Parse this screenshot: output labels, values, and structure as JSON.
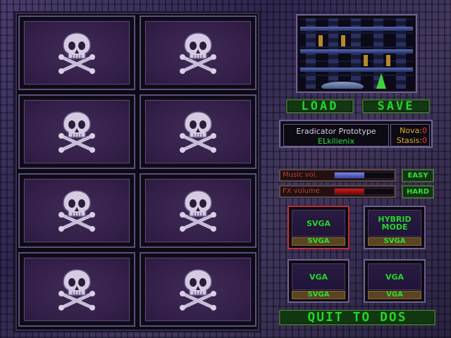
{
  "save_slots": [
    {
      "icon": "skull-crossbones-icon"
    },
    {
      "icon": "skull-crossbones-icon"
    },
    {
      "icon": "skull-crossbones-icon"
    },
    {
      "icon": "skull-crossbones-icon"
    },
    {
      "icon": "skull-crossbones-icon"
    },
    {
      "icon": "skull-crossbones-icon"
    },
    {
      "icon": "skull-crossbones-icon"
    },
    {
      "icon": "skull-crossbones-icon"
    }
  ],
  "actions": {
    "load": "LOAD",
    "save": "SAVE",
    "quit": "QUIT TO DOS"
  },
  "info": {
    "title": "Eradicator Prototype",
    "subtitle": "ELkilienix",
    "nova_label": "Nova:",
    "nova_value": "0",
    "stasis_label": "Stasis:",
    "stasis_value": "0"
  },
  "audio": {
    "music_label": "Music vol.",
    "music_level": 0.5,
    "music_color": "#7a86e0",
    "fx_label": "FX volume",
    "fx_level": 0.5,
    "fx_color": "#d01a1a"
  },
  "difficulty": {
    "easy": "EASY",
    "hard": "HARD"
  },
  "modes": [
    {
      "screen": "SVGA",
      "tag": "SVGA",
      "selected": true
    },
    {
      "screen": "HYBRID\nMODE",
      "tag": "SVGA",
      "selected": false
    },
    {
      "screen": "VGA",
      "tag": "SVGA",
      "selected": false
    },
    {
      "screen": "VGA",
      "tag": "VGA",
      "selected": false
    }
  ]
}
